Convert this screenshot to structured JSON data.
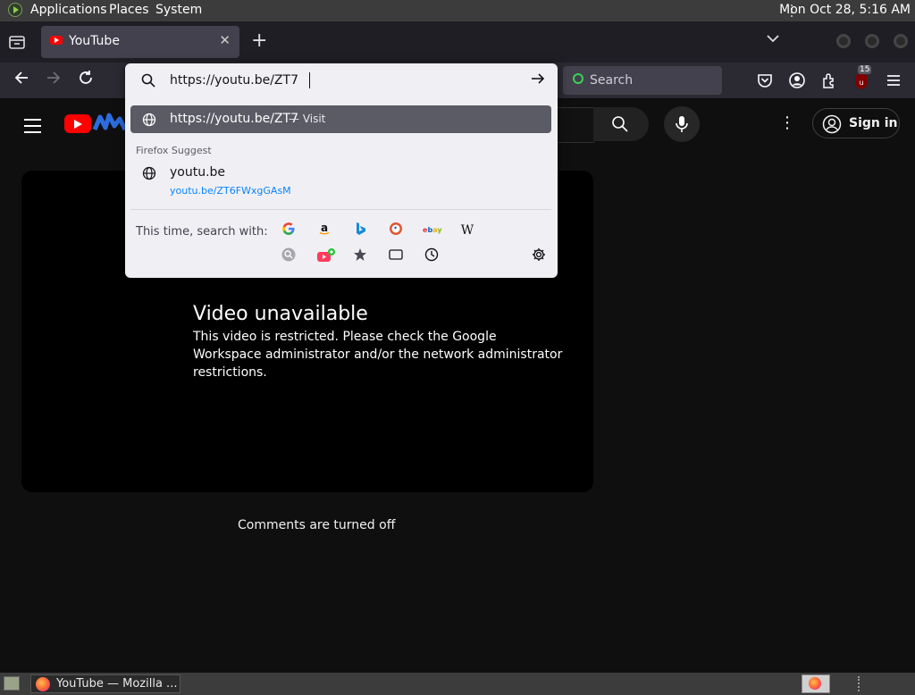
{
  "panel": {
    "applications": "Applications",
    "places": "Places",
    "system": "System",
    "clock": "Mon Oct 28,  5:16 AM"
  },
  "browser": {
    "tab_title": "YouTube",
    "search_placeholder": "Search",
    "extension_badge": "15",
    "url_value": "https://youtu.be/ZT7"
  },
  "url_popup": {
    "visit_url": "https://youtu.be/ZT7",
    "visit_action": "— Visit",
    "suggest_heading": "Firefox Suggest",
    "suggestion_title": "youtu.be",
    "suggestion_url": "youtu.be/ZT6FWxgGAsM",
    "search_with_label": "This time, search with:",
    "engines": [
      "google",
      "amazon",
      "bing",
      "duckduckgo",
      "ebay",
      "wikipedia",
      "search-engine-settings",
      "youtube",
      "bookmarks",
      "tabs",
      "history"
    ]
  },
  "youtube": {
    "signin_label": "Sign in",
    "unavailable_title": "Video unavailable",
    "unavailable_message": "This video is restricted. Please check the Google Workspace administrator and/or the network administrator restrictions.",
    "comments_off": "Comments are turned off"
  },
  "taskbar": {
    "task_label": "YouTube — Mozilla ..."
  },
  "colors": {
    "youtube_red": "#ff0000",
    "firefox_toolbar": "#2b2a33",
    "popup_bg": "#f0f0f4",
    "highlight_row": "#5b5b66",
    "link_blue": "#0a84ff"
  }
}
